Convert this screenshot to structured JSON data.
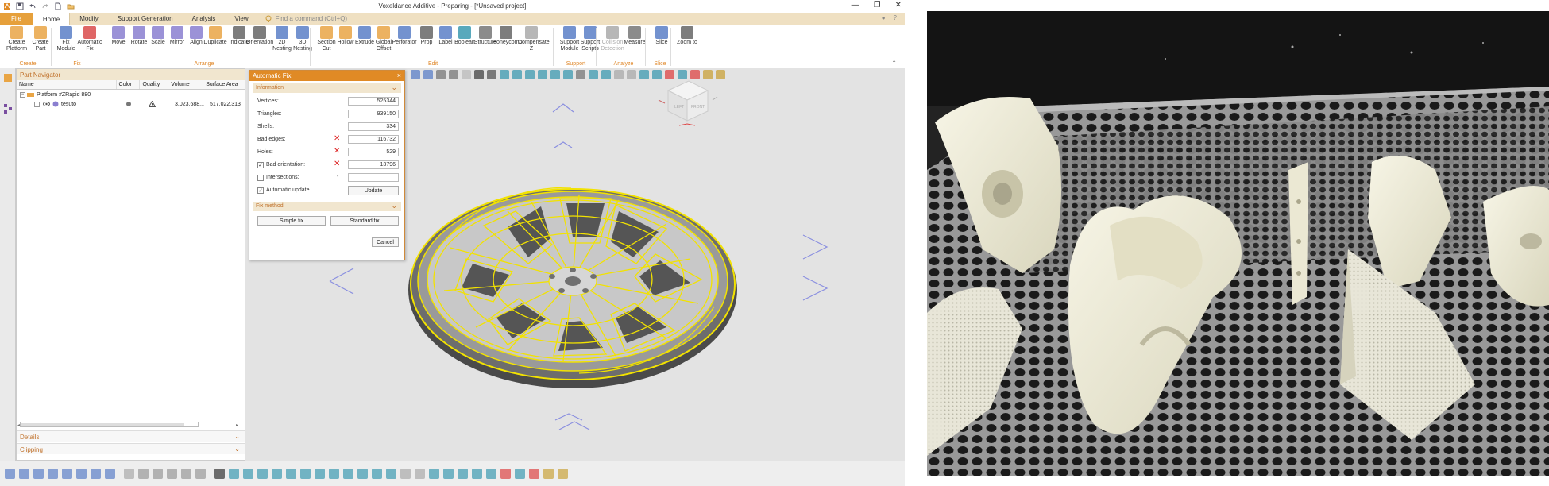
{
  "window": {
    "title": "Voxeldance Additive - Preparing - [*Unsaved project]",
    "controls": [
      "—",
      "❐",
      "✕"
    ]
  },
  "menubar": {
    "items": [
      "File",
      "Home",
      "Modify",
      "Support Generation",
      "Analysis",
      "View"
    ],
    "active": "Home",
    "search_placeholder": "Find a command (Ctrl+Q)"
  },
  "ribbon": {
    "buttons": [
      {
        "label": "Create\nPlatform",
        "icon": "create-platform-icon"
      },
      {
        "label": "Create\nPart",
        "icon": "create-part-icon"
      },
      {
        "label": "Fix\nModule",
        "icon": "fix-module-icon"
      },
      {
        "label": "Automatic\nFix",
        "icon": "automatic-fix-icon"
      },
      {
        "label": "Move",
        "icon": "move-icon"
      },
      {
        "label": "Rotate",
        "icon": "rotate-icon"
      },
      {
        "label": "Scale",
        "icon": "scale-icon"
      },
      {
        "label": "Mirror",
        "icon": "mirror-icon"
      },
      {
        "label": "Align",
        "icon": "align-icon"
      },
      {
        "label": "Duplicate",
        "icon": "duplicate-icon"
      },
      {
        "label": "Indicate",
        "icon": "indicate-icon"
      },
      {
        "label": "Orientation",
        "icon": "orientation-icon"
      },
      {
        "label": "2D\nNesting",
        "icon": "nesting-2d-icon"
      },
      {
        "label": "3D\nNesting",
        "icon": "nesting-3d-icon"
      },
      {
        "label": "Section\nCut",
        "icon": "section-cut-icon"
      },
      {
        "label": "Hollow",
        "icon": "hollow-icon"
      },
      {
        "label": "Extrude",
        "icon": "extrude-icon"
      },
      {
        "label": "Global\nOffset",
        "icon": "global-offset-icon"
      },
      {
        "label": "Perforator",
        "icon": "perforator-icon"
      },
      {
        "label": "Prop",
        "icon": "prop-icon"
      },
      {
        "label": "Label",
        "icon": "label-icon"
      },
      {
        "label": "Boolean",
        "icon": "boolean-icon"
      },
      {
        "label": "Structure",
        "icon": "structure-icon"
      },
      {
        "label": "Honeycomb",
        "icon": "honeycomb-icon"
      },
      {
        "label": "Compensate\nZ",
        "icon": "compensate-z-icon"
      },
      {
        "label": "Support\nModule",
        "icon": "support-module-icon"
      },
      {
        "label": "Support\nScripts",
        "icon": "support-scripts-icon"
      },
      {
        "label": "Collision\nDetection",
        "icon": "collision-detection-icon"
      },
      {
        "label": "Measure",
        "icon": "measure-icon"
      },
      {
        "label": "Slice",
        "icon": "slice-icon"
      },
      {
        "label": "Zoom to",
        "icon": "zoom-to-icon"
      }
    ],
    "groups": [
      "Create",
      "Fix",
      "Arrange",
      "Edit",
      "Support",
      "Analyze",
      "Slice"
    ]
  },
  "part_navigator": {
    "title": "Part Navigator",
    "columns": [
      "Name",
      "Color",
      "Quality",
      "Volume",
      "Surface Area"
    ],
    "rows": [
      {
        "name": "Platform #ZRapid 880",
        "color": "",
        "quality": "",
        "volume": "",
        "surface_area": ""
      },
      {
        "name": "tesuto",
        "color": "",
        "quality": "",
        "volume": "3,023,688...",
        "surface_area": "517,022.313"
      }
    ],
    "footer": [
      "Details",
      "Clipping"
    ]
  },
  "automatic_fix": {
    "title": "Automatic Fix",
    "information_label": "Information",
    "fields": [
      {
        "label": "Vertices:",
        "value": "525344",
        "error": false,
        "checkbox": false
      },
      {
        "label": "Triangles:",
        "value": "939150",
        "error": false,
        "checkbox": false
      },
      {
        "label": "Shells:",
        "value": "334",
        "error": false,
        "checkbox": false
      },
      {
        "label": "Bad edges:",
        "value": "116732",
        "error": true,
        "checkbox": false
      },
      {
        "label": "Holes:",
        "value": "529",
        "error": true,
        "checkbox": false
      },
      {
        "label": "Bad orientation:",
        "value": "13796",
        "error": true,
        "checkbox": true,
        "checked": true
      },
      {
        "label": "Intersections:",
        "value": "",
        "error": false,
        "checkbox": true,
        "checked": false
      }
    ],
    "intersections_dash": "-",
    "auto_update_label": "Automatic update",
    "update_button": "Update",
    "fix_method_label": "Fix method",
    "simple_fix": "Simple fix",
    "standard_fix": "Standard fix",
    "cancel": "Cancel"
  },
  "viewcube": {
    "faces": [
      "FRONT",
      "LEFT"
    ]
  },
  "colors": {
    "accent": "#e08a25",
    "menubar_bg": "#efe0c2",
    "mesh_highlight": "#f2e200",
    "error_red": "#d22222"
  }
}
